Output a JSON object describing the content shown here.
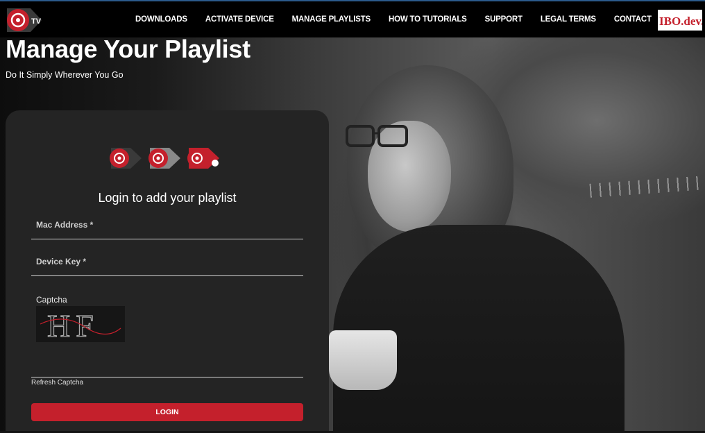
{
  "nav": {
    "items": [
      {
        "label": "DOWNLOADS"
      },
      {
        "label": "ACTIVATE DEVICE"
      },
      {
        "label": "MANAGE PLAYLISTS"
      },
      {
        "label": "HOW TO TUTORIALS"
      },
      {
        "label": "SUPPORT"
      },
      {
        "label": "LEGAL TERMS"
      },
      {
        "label": "CONTACT"
      }
    ],
    "logo_text": "TV",
    "brand_text": "IBO.dev."
  },
  "hero": {
    "title": "Manage Your Playlist",
    "subtitle": "Do It Simply Wherever You Go"
  },
  "login": {
    "title": "Login to add your playlist",
    "mac_label": "Mac Address *",
    "device_key_label": "Device Key *",
    "captcha_label": "Captcha",
    "captcha_text": "HF",
    "refresh_label": "Refresh Captcha",
    "button_label": "LOGIN"
  },
  "colors": {
    "accent": "#c4202c",
    "nav_bg": "#000000",
    "card_bg": "#242424"
  }
}
